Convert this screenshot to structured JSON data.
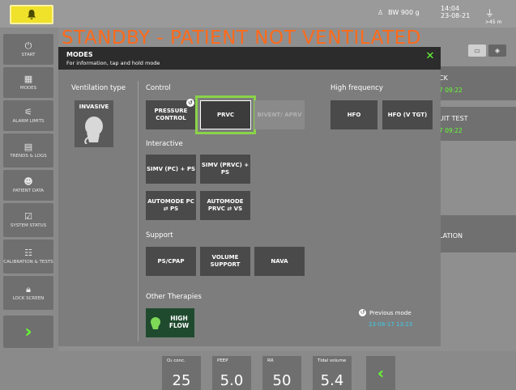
{
  "topbar": {
    "body_weight": "BW 900 g",
    "time": "14:04",
    "date": "23-08-21",
    "battery_text": ">45 m"
  },
  "status_title": "STANDBY - PATIENT NOT VENTILATED",
  "sidebar": {
    "items": [
      {
        "label": "START",
        "icon": "power-icon"
      },
      {
        "label": "MODES",
        "icon": "grid-icon"
      },
      {
        "label": "ALARM LIMITS",
        "icon": "alarm-limits-icon"
      },
      {
        "label": "TRENDS & LOGS",
        "icon": "trends-icon"
      },
      {
        "label": "PATIENT DATA",
        "icon": "patient-icon"
      },
      {
        "label": "SYSTEM STATUS",
        "icon": "system-icon"
      },
      {
        "label": "CALIBRATION & TESTS",
        "icon": "calibration-icon"
      },
      {
        "label": "LOCK SCREEN",
        "icon": "lock-icon"
      }
    ]
  },
  "bg_cards": [
    {
      "line1": "CK",
      "line2": "7 09:22"
    },
    {
      "line1": "UIT TEST",
      "line2": "7 09:22"
    },
    {
      "line1": "LATION",
      "line2": ""
    }
  ],
  "modal": {
    "title": "MODES",
    "subtitle": "For information, tap and hold mode",
    "close": "✕",
    "ventilation_type_label": "Ventilation type",
    "invasive_label": "INVASIVE",
    "control_label": "Control",
    "high_frequency_label": "High frequency",
    "interactive_label": "Interactive",
    "support_label": "Support",
    "other_therapies_label": "Other Therapies",
    "control_modes": [
      "PRESSURE CONTROL",
      "PRVC",
      "BIVENT/ APRV"
    ],
    "hf_modes": [
      "HFO",
      "HFO (V TGT)"
    ],
    "interactive_modes": [
      "SIMV (PC) + PS",
      "SIMV (PRVC) + PS",
      "AUTOMODE PC ⇄ PS",
      "AUTOMODE PRVC ⇄ VS"
    ],
    "support_modes": [
      "PS/CPAP",
      "VOLUME SUPPORT",
      "NAVA"
    ],
    "high_flow_label": "HIGH FLOW",
    "previous_mode_label": "Previous mode",
    "previous_mode_date": "23-08-17 13:23",
    "selected_mode": "PRVC"
  },
  "bottom_params": [
    {
      "label": "O₂ conc.",
      "value": "25"
    },
    {
      "label": "PEEP",
      "value": "5.0"
    },
    {
      "label": "RR",
      "value": "50"
    },
    {
      "label": "Tidal volume",
      "value": "5.4"
    }
  ],
  "colors": {
    "accent_green": "#66ff33",
    "status_orange": "#ff6a1a",
    "alarm_yellow": "#f0e12a",
    "previous_date_cyan": "#3ec9e8"
  }
}
